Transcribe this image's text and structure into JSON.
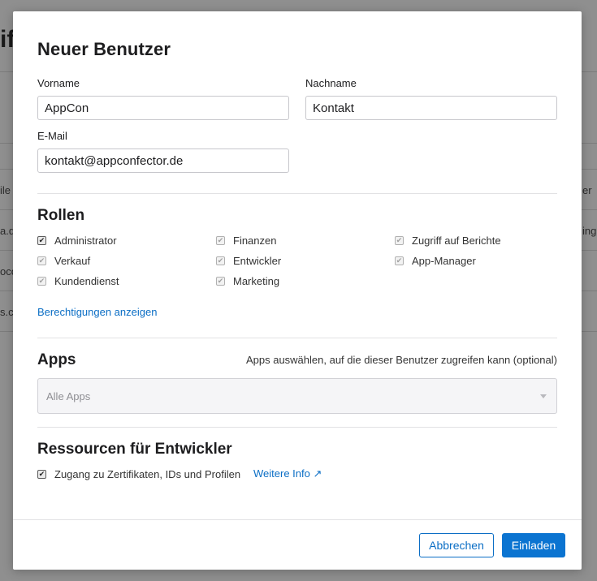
{
  "background": {
    "title_fragment": "if",
    "fragments": [
      "ile",
      "a.d",
      "oco",
      "s.c",
      "er",
      "ing"
    ]
  },
  "modal": {
    "title": "Neuer Benutzer",
    "fields": {
      "first_name_label": "Vorname",
      "first_name_value": "AppCon",
      "last_name_label": "Nachname",
      "last_name_value": "Kontakt",
      "email_label": "E-Mail",
      "email_value": "kontakt@appconfector.de"
    },
    "roles": {
      "title": "Rollen",
      "items": [
        {
          "label": "Administrator",
          "checked": true,
          "enabled": true
        },
        {
          "label": "Finanzen",
          "checked": true,
          "enabled": false
        },
        {
          "label": "Zugriff auf Berichte",
          "checked": true,
          "enabled": false
        },
        {
          "label": "Verkauf",
          "checked": true,
          "enabled": false
        },
        {
          "label": "Entwickler",
          "checked": true,
          "enabled": false
        },
        {
          "label": "App-Manager",
          "checked": true,
          "enabled": false
        },
        {
          "label": "Kundendienst",
          "checked": true,
          "enabled": false
        },
        {
          "label": "Marketing",
          "checked": true,
          "enabled": false
        }
      ],
      "permissions_link": "Berechtigungen anzeigen"
    },
    "apps": {
      "title": "Apps",
      "hint": "Apps auswählen, auf die dieser Benutzer zugreifen kann (optional)",
      "select_value": "Alle Apps"
    },
    "developer_resources": {
      "title": "Ressourcen für Entwickler",
      "checkbox_label": "Zugang zu Zertifikaten, IDs und Profilen",
      "more_info_link": "Weitere Info ↗"
    },
    "buttons": {
      "cancel": "Abbrechen",
      "invite": "Einladen"
    }
  },
  "colors": {
    "accent": "#0b74d1",
    "link": "#0b6ec5",
    "overlay": "#8f8f8f"
  }
}
